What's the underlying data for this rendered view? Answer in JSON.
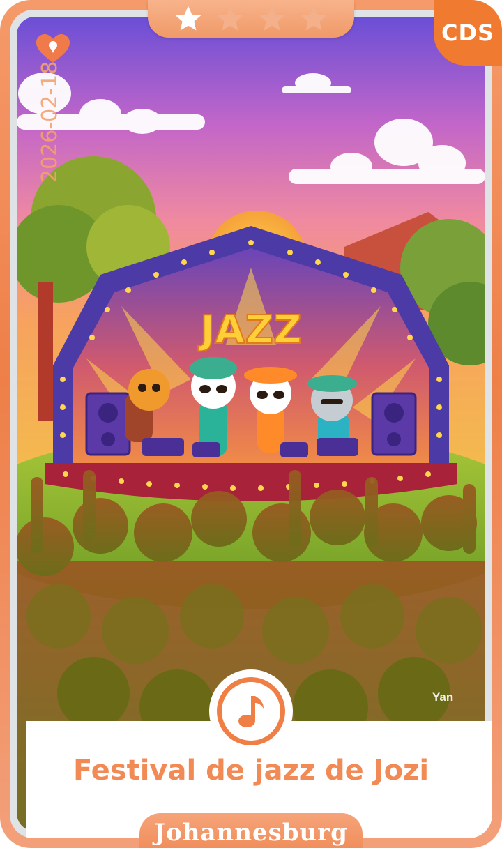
{
  "card": {
    "badge": "CDS",
    "date": "2026-02-18",
    "stage_sign": "JAZZ",
    "artist": "Yan",
    "title": "Festival de jazz de Jozi",
    "city": "Johannesburg",
    "rating": {
      "filled": 1,
      "total": 4
    }
  },
  "icons": {
    "stars": "star-icon",
    "favorite": "heart-icon",
    "audio": "music-note-icon"
  },
  "colors": {
    "accent": "#f07a30",
    "title": "#f18a55",
    "star_filled": "#ffffff",
    "star_empty": "#f4b08a"
  }
}
